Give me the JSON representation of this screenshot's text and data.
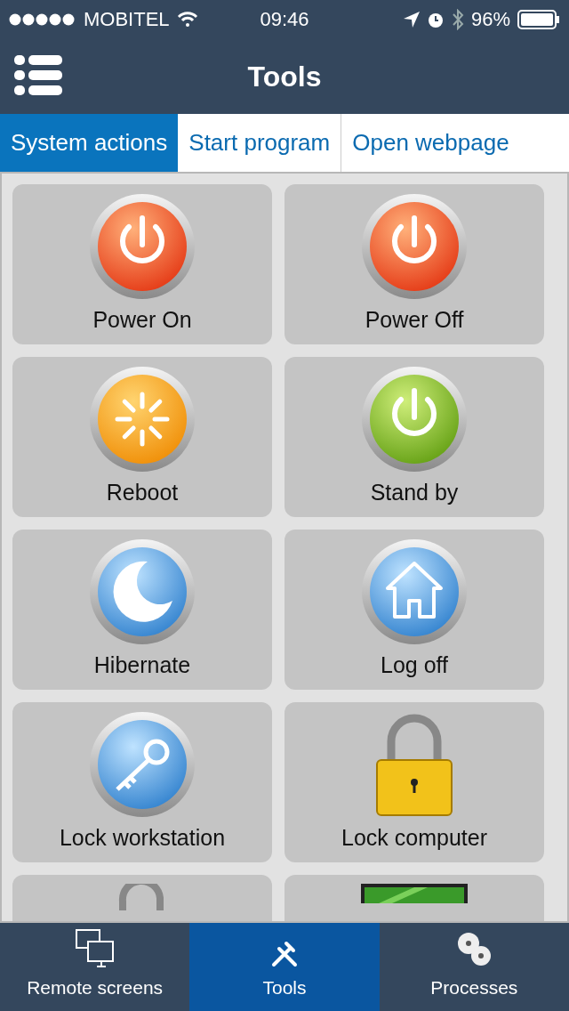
{
  "status_bar": {
    "carrier": "MOBITEL",
    "time": "09:46",
    "battery": "96%"
  },
  "nav": {
    "title": "Tools"
  },
  "tabs": [
    {
      "label": "System actions",
      "selected": true
    },
    {
      "label": "Start program",
      "selected": false
    },
    {
      "label": "Open webpage",
      "selected": false
    }
  ],
  "actions": [
    {
      "label": "Power On",
      "kind": "power-red"
    },
    {
      "label": "Power Off",
      "kind": "power-red"
    },
    {
      "label": "Reboot",
      "kind": "reboot"
    },
    {
      "label": "Stand by",
      "kind": "power-green"
    },
    {
      "label": "Hibernate",
      "kind": "moon"
    },
    {
      "label": "Log off",
      "kind": "home"
    },
    {
      "label": "Lock workstation",
      "kind": "key"
    },
    {
      "label": "Lock computer",
      "kind": "padlock"
    },
    {
      "kind": "unlock"
    },
    {
      "kind": "monitor"
    }
  ],
  "bottom_tabs": [
    {
      "label": "Remote screens",
      "kind": "screens",
      "selected": false
    },
    {
      "label": "Tools",
      "kind": "tools",
      "selected": true
    },
    {
      "label": "Processes",
      "kind": "gears",
      "selected": false
    }
  ]
}
